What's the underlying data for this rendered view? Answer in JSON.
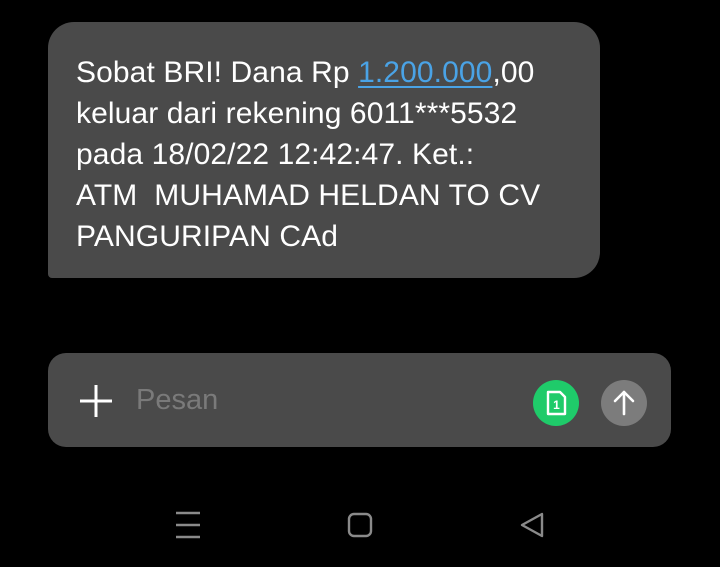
{
  "message": {
    "line1_prefix": "Sobat BRI! Dana Rp ",
    "line1_amount": "1.200.000",
    "line1_suffix": ",00",
    "line2": "keluar dari rekening 6011***5532",
    "line3": "pada 18/02/22 12:42:47. Ket.:",
    "line4": "ATM  MUHAMAD HELDAN TO CV",
    "line5": "PANGURIPAN CAd"
  },
  "composer": {
    "placeholder": "Pesan",
    "value": "",
    "add_icon": "plus-icon",
    "sim_icon": "sim-card-1-icon",
    "sim_label": "1",
    "send_icon": "arrow-up-icon"
  },
  "navbar": {
    "menu_icon": "menu-lines-icon",
    "home_icon": "square-home-icon",
    "back_icon": "triangle-back-icon"
  },
  "colors": {
    "background": "#000000",
    "bubble": "#4a4a4a",
    "link": "#4aa3e6",
    "sim_green": "#1fcb6a",
    "send_gray": "#7c7c7c",
    "placeholder": "#7a7a7a"
  }
}
